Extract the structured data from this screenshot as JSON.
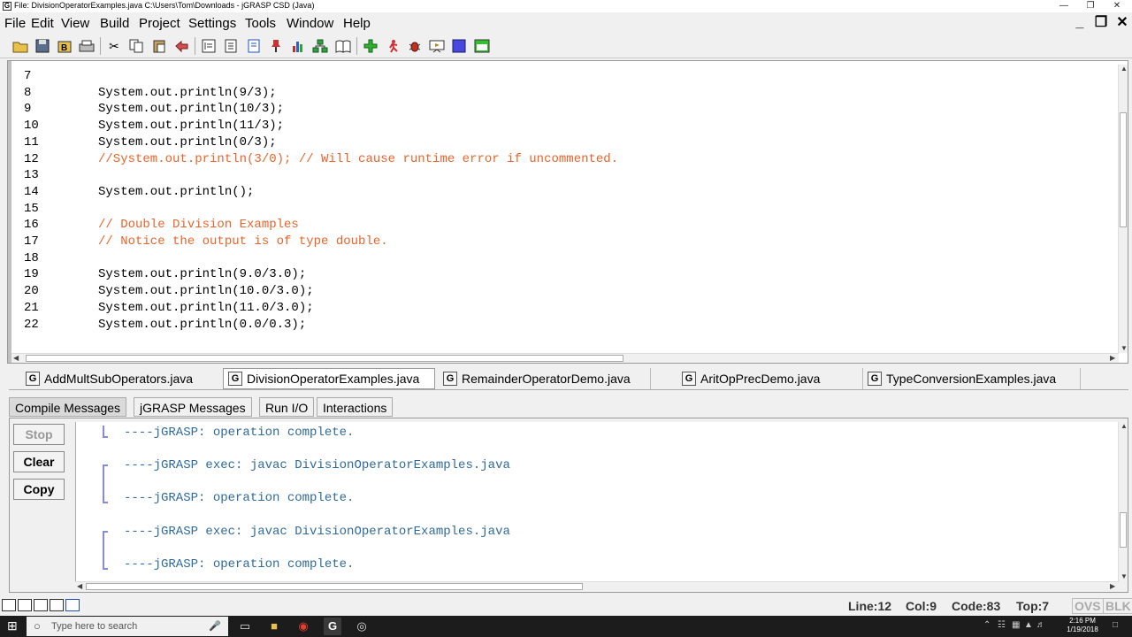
{
  "window": {
    "title": "File: DivisionOperatorExamples.java  C:\\Users\\Tom\\Downloads - jGRASP CSD (Java)",
    "app_icon": "G"
  },
  "menu": [
    "File",
    "Edit",
    "View",
    "Build",
    "Project",
    "Settings",
    "Tools",
    "Window",
    "Help"
  ],
  "code": [
    {
      "n": "7",
      "t": "",
      "c": false
    },
    {
      "n": "8",
      "t": "System.out.println(9/3);",
      "c": false
    },
    {
      "n": "9",
      "t": "System.out.println(10/3);",
      "c": false
    },
    {
      "n": "10",
      "t": "System.out.println(11/3);",
      "c": false
    },
    {
      "n": "11",
      "t": "System.out.println(0/3);",
      "c": false
    },
    {
      "n": "12",
      "t": "//System.out.println(3/0); // Will cause runtime error if uncommented.",
      "c": true
    },
    {
      "n": "13",
      "t": "",
      "c": false
    },
    {
      "n": "14",
      "t": "System.out.println();",
      "c": false
    },
    {
      "n": "15",
      "t": "",
      "c": false
    },
    {
      "n": "16",
      "t": "// Double Division Examples",
      "c": true
    },
    {
      "n": "17",
      "t": "// Notice the output is of type double.",
      "c": true
    },
    {
      "n": "18",
      "t": "",
      "c": false
    },
    {
      "n": "19",
      "t": "System.out.println(9.0/3.0);",
      "c": false
    },
    {
      "n": "20",
      "t": "System.out.println(10.0/3.0);",
      "c": false
    },
    {
      "n": "21",
      "t": "System.out.println(11.0/3.0);",
      "c": false
    },
    {
      "n": "22",
      "t": "System.out.println(0.0/0.3);",
      "c": false
    }
  ],
  "file_tabs": [
    {
      "label": "AddMultSubOperators.java",
      "active": false
    },
    {
      "label": "DivisionOperatorExamples.java",
      "active": true
    },
    {
      "label": "RemainderOperatorDemo.java",
      "active": false
    },
    {
      "label": "AritOpPrecDemo.java",
      "active": false
    },
    {
      "label": "TypeConversionExamples.java",
      "active": false
    }
  ],
  "message_tabs": [
    {
      "label": "Compile Messages",
      "active": true
    },
    {
      "label": "jGRASP Messages",
      "active": false
    },
    {
      "label": "Run I/O",
      "active": false
    },
    {
      "label": "Interactions",
      "active": false
    }
  ],
  "side_buttons": {
    "stop": "Stop",
    "clear": "Clear",
    "copy": "Copy"
  },
  "messages": [
    "----jGRASP: operation complete.",
    "----jGRASP exec: javac DivisionOperatorExamples.java",
    "----jGRASP: operation complete.",
    "----jGRASP exec: javac DivisionOperatorExamples.java",
    "----jGRASP: operation complete."
  ],
  "status": {
    "line": "Line:12",
    "col": "Col:9",
    "code": "Code:83",
    "top": "Top:7",
    "ovs": "OVS",
    "blk": "BLK"
  },
  "taskbar": {
    "search_placeholder": "Type here to search",
    "time": "2:16 PM",
    "date": "1/19/2018"
  }
}
